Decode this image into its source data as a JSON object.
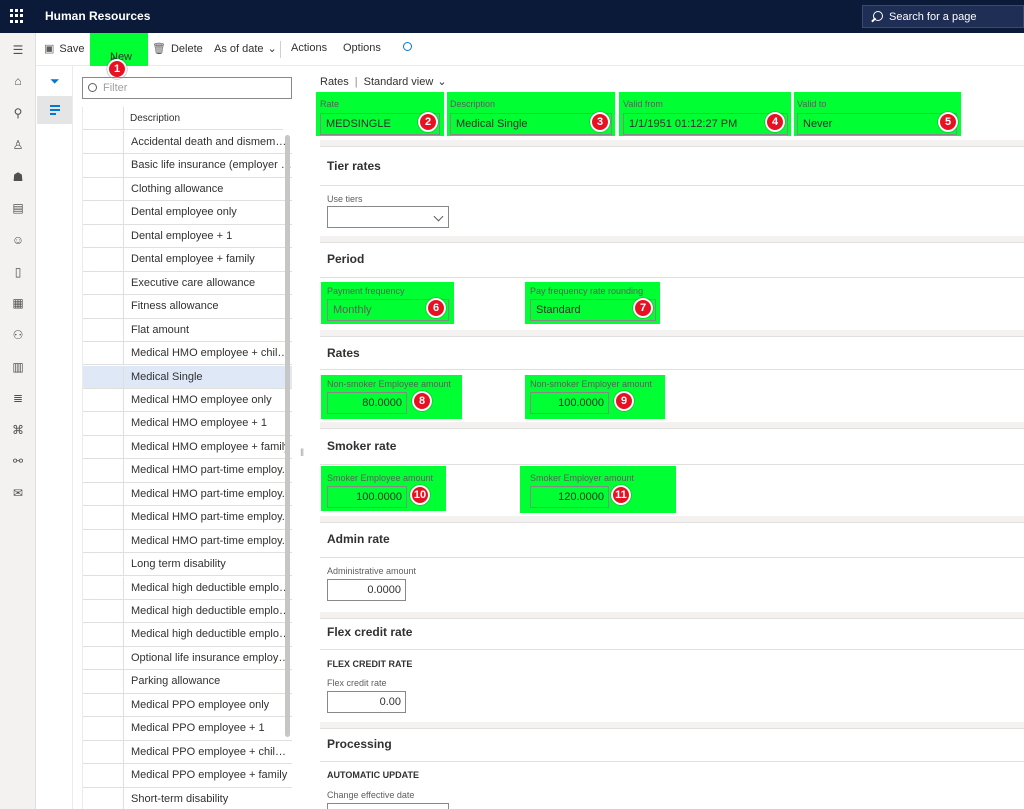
{
  "app": {
    "title": "Human Resources",
    "search_label": "Search for a page"
  },
  "toolbar": {
    "save": "Save",
    "new": "New",
    "delete": "Delete",
    "as_of_date": "As of date",
    "actions": "Actions",
    "options": "Options"
  },
  "list": {
    "filter_placeholder": "Filter",
    "column_header": "Description",
    "rows": [
      "Accidental death and dismembe...",
      "Basic life insurance (employer p...",
      "Clothing allowance",
      "Dental employee only",
      "Dental employee + 1",
      "Dental employee + family",
      "Executive care allowance",
      "Fitness allowance",
      "Flat amount",
      "Medical HMO employee + child...",
      "Medical Single",
      "Medical HMO employee only",
      "Medical HMO employee + 1",
      "Medical HMO employee + family",
      "Medical HMO part-time employ...",
      "Medical HMO part-time employ...",
      "Medical HMO part-time employ...",
      "Medical HMO part-time employ...",
      "Long term disability",
      "Medical high deductible employ...",
      "Medical high deductible employ...",
      "Medical high deductible employ...",
      "Optional life insurance employe...",
      "Parking allowance",
      "Medical PPO employee only",
      "Medical PPO employee + 1",
      "Medical PPO employee + children",
      "Medical PPO employee + family",
      "Short-term disability"
    ],
    "selected_index": 10
  },
  "breadcrumb": {
    "page": "Rates",
    "view": "Standard view"
  },
  "header": {
    "rate_label": "Rate",
    "rate_value": "MEDSINGLE",
    "description_label": "Description",
    "description_value": "Medical Single",
    "valid_from_label": "Valid from",
    "valid_from_value": "1/1/1951 01:12:27 PM",
    "valid_to_label": "Valid to",
    "valid_to_value": "Never"
  },
  "tier_rates": {
    "title": "Tier rates",
    "use_tiers_label": "Use tiers",
    "use_tiers_value": ""
  },
  "period": {
    "title": "Period",
    "payment_frequency_label": "Payment frequency",
    "payment_frequency_value": "Monthly",
    "rounding_label": "Pay frequency rate rounding",
    "rounding_value": "Standard"
  },
  "rates": {
    "title": "Rates",
    "employee_label": "Non-smoker Employee amount",
    "employee_value": "80.0000",
    "employer_label": "Non-smoker Employer amount",
    "employer_value": "100.0000"
  },
  "smoker": {
    "title": "Smoker rate",
    "employee_label": "Smoker Employee amount",
    "employee_value": "100.0000",
    "employer_label": "Smoker Employer amount",
    "employer_value": "120.0000"
  },
  "admin": {
    "title": "Admin rate",
    "amount_label": "Administrative amount",
    "amount_value": "0.0000"
  },
  "flex": {
    "title": "Flex credit rate",
    "subhead": "FLEX CREDIT RATE",
    "label": "Flex credit rate",
    "value": "0.00"
  },
  "processing": {
    "title": "Processing",
    "subhead": "AUTOMATIC UPDATE",
    "label": "Change effective date"
  },
  "badges": [
    "1",
    "2",
    "3",
    "4",
    "5",
    "6",
    "7",
    "8",
    "9",
    "10",
    "11"
  ],
  "colors": {
    "highlight": "#00ff33",
    "badge": "#e81123",
    "topbar": "#0c1a3a",
    "selected_row": "#dee8f7"
  }
}
